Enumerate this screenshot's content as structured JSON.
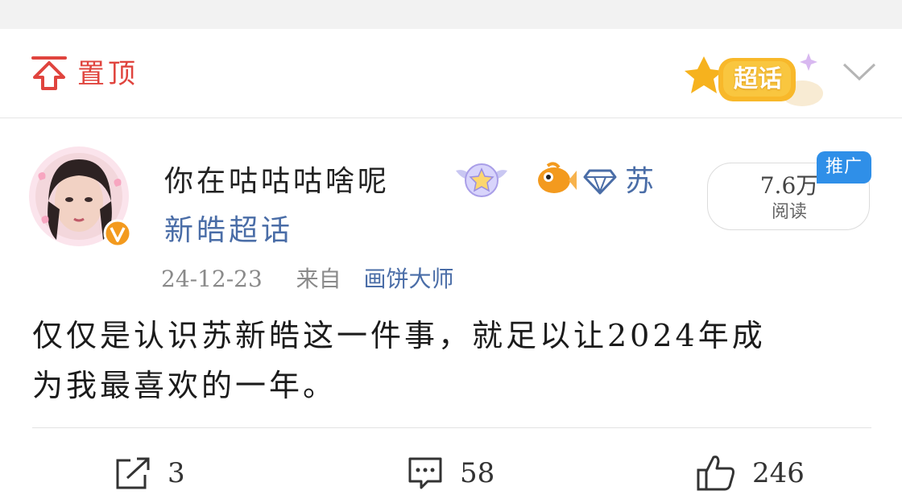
{
  "header": {
    "pin_label": "置顶",
    "badge_label": "超话"
  },
  "author": {
    "username": "你在咕咕咕啥呢",
    "topic_line1": "苏",
    "topic_line2": "新皓超话",
    "verified_badge": "V"
  },
  "stats_badge": {
    "read_count": "7.6万",
    "read_label": "阅读",
    "promo_label": "推广"
  },
  "meta": {
    "date": "24-12-23",
    "from_label": "来自",
    "source": "画饼大师"
  },
  "post": {
    "line1": "仅仅是认识苏新皓这一件事，就足以让2024年成",
    "line2": "为我最喜欢的一年。"
  },
  "actions": {
    "repost_count": "3",
    "comment_count": "58",
    "like_count": "246"
  },
  "colors": {
    "accent_red": "#e0443e",
    "link_blue": "#4a6da7",
    "promo_blue": "#2f8fe8",
    "verified_orange": "#f39a1e"
  }
}
